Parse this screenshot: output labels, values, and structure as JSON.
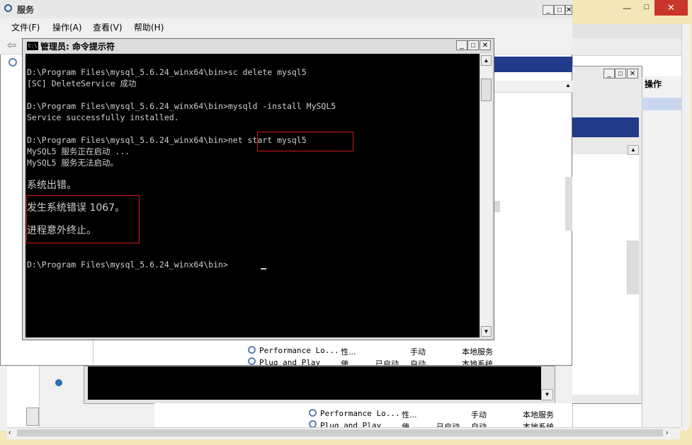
{
  "services_bg": {
    "title": "服务",
    "menu": [
      "文件(F)",
      "操作(A)",
      "查看(V)",
      "帮助(H)"
    ],
    "controls": [
      "_",
      "□",
      "✕"
    ],
    "rows": [
      {
        "name": "Performance Lo...",
        "desc": "性...",
        "status": "",
        "startup": "手动",
        "logon": "本地服务"
      },
      {
        "name": "Plug and Play",
        "desc": "使...",
        "status": "已启动",
        "startup": "自动",
        "logon": "本地系统"
      }
    ]
  },
  "actions_panel": {
    "title": "操作"
  },
  "back_window": {
    "rows": [
      {
        "name": "Performance Lo...",
        "desc": "性...",
        "status": "",
        "startup": "手动",
        "logon": "本地服务"
      },
      {
        "name": "Plug and Play",
        "desc": "使...",
        "status": "已启动",
        "startup": "自动",
        "logon": "本地系统"
      }
    ]
  },
  "console": {
    "icon_text": "C:\\",
    "title": "管理员: 命令提示符",
    "lines": [
      "D:\\Program Files\\mysql_5.6.24_winx64\\bin>sc delete mysql5",
      "[SC] DeleteService 成功",
      "",
      "D:\\Program Files\\mysql_5.6.24_winx64\\bin>mysqld -install MySQL5",
      "Service successfully installed.",
      "",
      "D:\\Program Files\\mysql_5.6.24_winx64\\bin>net start mysql5",
      "MySQL5 服务正在启动 ...",
      "MySQL5 服务无法启动。",
      "系统出错。",
      "发生系统错误 1067。",
      "进程意外终止。",
      "D:\\Program Files\\mysql_5.6.24_winx64\\bin>"
    ]
  }
}
